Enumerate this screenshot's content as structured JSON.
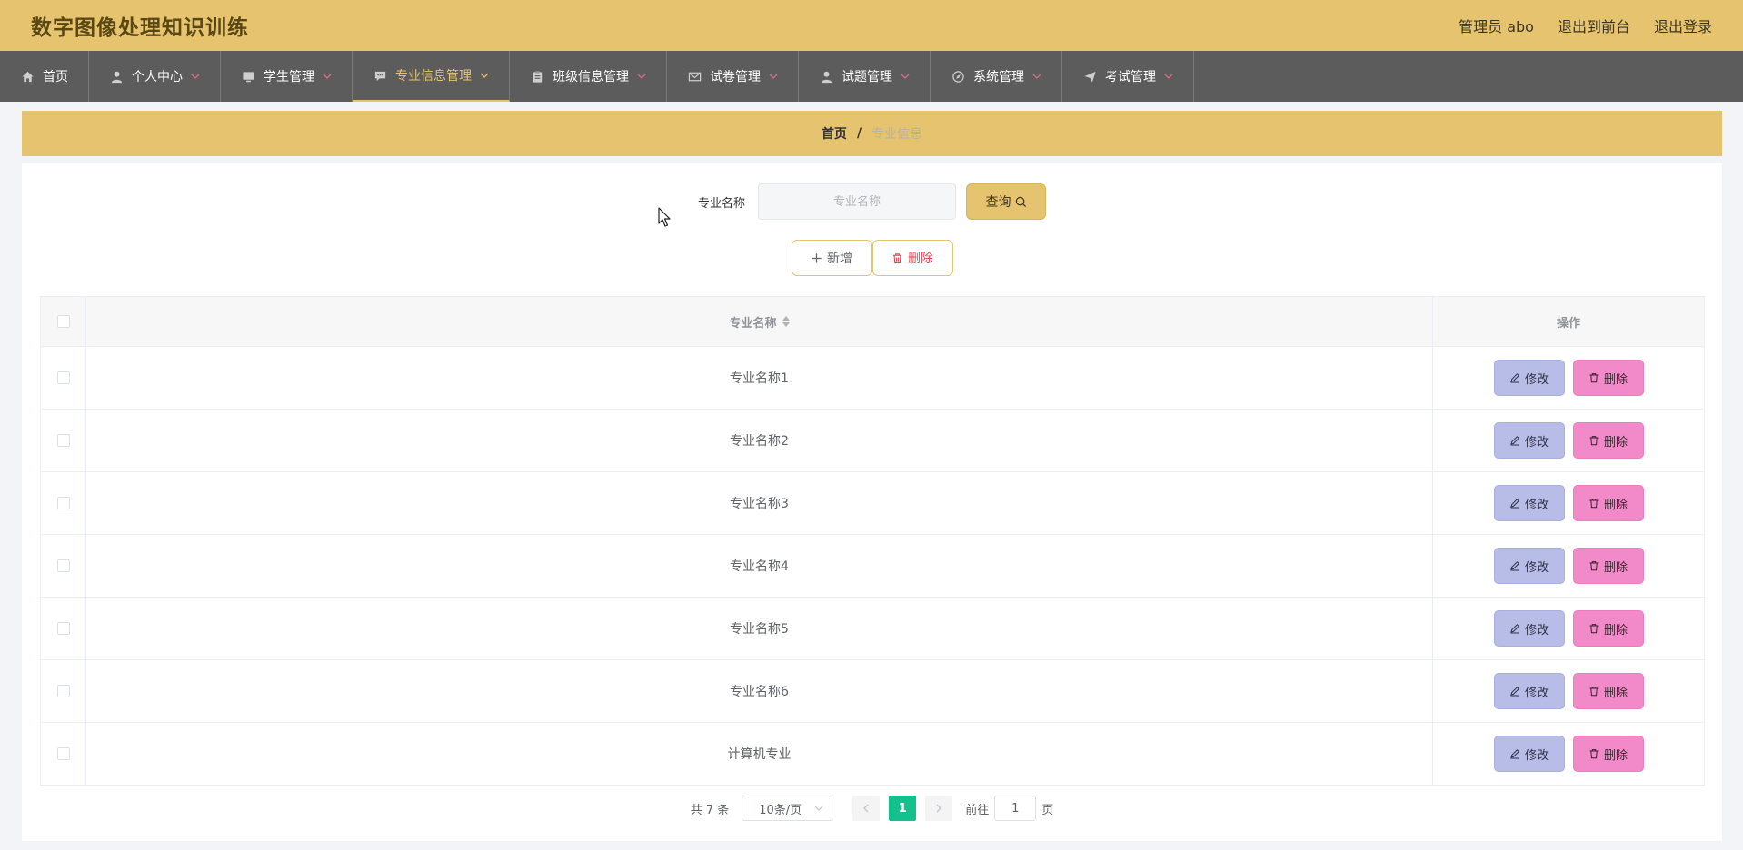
{
  "app_title": "数字图像处理知识训练",
  "header": {
    "admin_label": "管理员 abo",
    "to_front": "退出到前台",
    "logout": "退出登录"
  },
  "nav": {
    "items": [
      {
        "label": "首页",
        "icon": "home-icon"
      },
      {
        "label": "个人中心",
        "icon": "user-icon"
      },
      {
        "label": "学生管理",
        "icon": "monitor-icon"
      },
      {
        "label": "专业信息管理",
        "icon": "chat-icon"
      },
      {
        "label": "班级信息管理",
        "icon": "clipboard-icon"
      },
      {
        "label": "试卷管理",
        "icon": "mail-icon"
      },
      {
        "label": "试题管理",
        "icon": "user-icon"
      },
      {
        "label": "系统管理",
        "icon": "compass-icon"
      },
      {
        "label": "考试管理",
        "icon": "send-icon"
      }
    ],
    "active_index": 3
  },
  "breadcrumb": {
    "home": "首页",
    "separator": "/",
    "current": "专业信息"
  },
  "search": {
    "label": "专业名称",
    "placeholder": "专业名称",
    "value": "",
    "button": "查询"
  },
  "actions": {
    "add": "新增",
    "delete": "删除"
  },
  "table": {
    "columns": [
      "专业名称",
      "操作"
    ],
    "rows": [
      {
        "name": "专业名称1"
      },
      {
        "name": "专业名称2"
      },
      {
        "name": "专业名称3"
      },
      {
        "name": "专业名称4"
      },
      {
        "name": "专业名称5"
      },
      {
        "name": "专业名称6"
      },
      {
        "name": "计算机专业"
      }
    ],
    "edit_label": "修改",
    "delete_label": "删除"
  },
  "pagination": {
    "total_text": "共 7 条",
    "page_size": "10条/页",
    "current_page": "1",
    "goto_prefix": "前往",
    "goto_value": "1",
    "goto_suffix": "页"
  },
  "colors": {
    "accent": "#e6c36f",
    "nav_bg": "#5c5c5c",
    "edit_btn": "#b7bde6",
    "delete_btn": "#f28ac9",
    "page_active": "#13c08e"
  }
}
